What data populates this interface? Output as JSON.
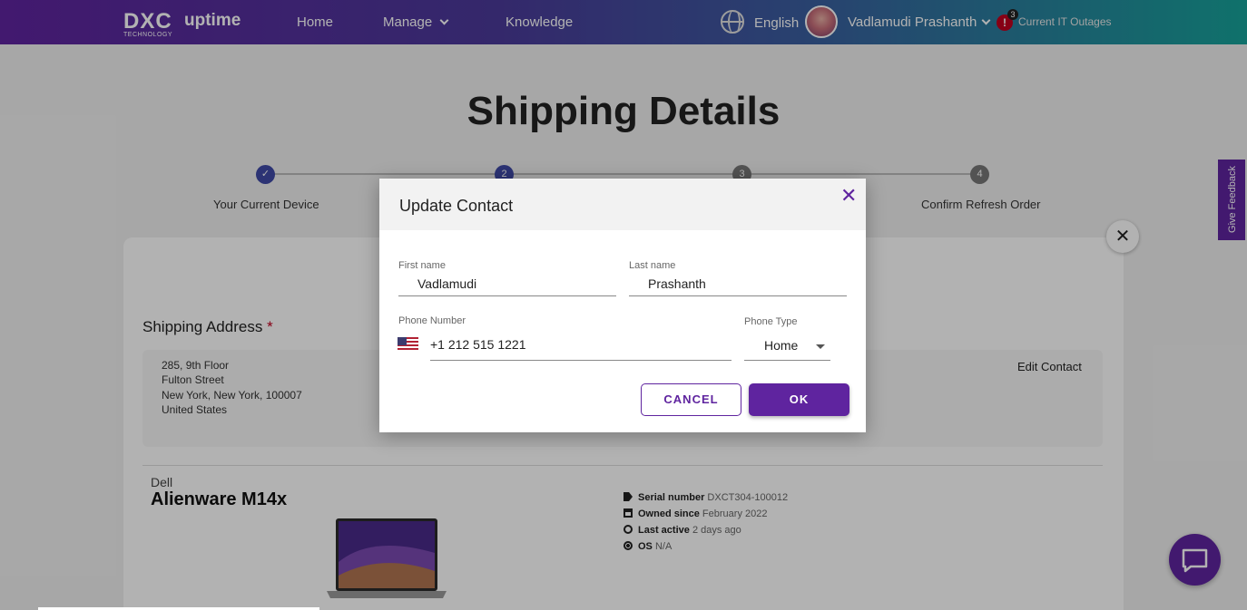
{
  "header": {
    "logo_dxc": "DXC",
    "logo_tech": "TECHNOLOGY",
    "logo_uptime": "uptime",
    "nav_home": "Home",
    "nav_manage": "Manage",
    "nav_knowledge": "Knowledge",
    "language": "English",
    "user_name": "Vadlamudi Prashanth",
    "alert_icon_text": "!",
    "alert_count": "3",
    "outages_label": "Current IT Outages"
  },
  "page": {
    "title": "Shipping Details",
    "steps": [
      {
        "number": "",
        "label": "Your Current Device"
      },
      {
        "number": "2",
        "label": ""
      },
      {
        "number": "3",
        "label": ""
      },
      {
        "number": "4",
        "label": "Confirm Refresh Order"
      }
    ],
    "shipping_address_label": "Shipping Address",
    "required_mark": "*",
    "address_lines": [
      "285, 9th Floor",
      "Fulton Street",
      "New York, New York, 100007",
      "United States"
    ],
    "edit_contact": "Edit Contact",
    "device": {
      "brand": "Dell",
      "model": "Alienware M14x",
      "specs": [
        {
          "label": "Serial number",
          "value": "DXCT304-100012",
          "icon": "tag-icon"
        },
        {
          "label": "Owned since",
          "value": "February 2022",
          "icon": "calendar-icon"
        },
        {
          "label": "Last active",
          "value": "2 days ago",
          "icon": "clock-icon"
        },
        {
          "label": "OS",
          "value": "N/A",
          "icon": "os-icon"
        }
      ]
    },
    "feedback_tab": "Give Feedback"
  },
  "modal": {
    "title": "Update Contact",
    "first_name_label": "First name",
    "first_name_value": "Vadlamudi",
    "last_name_label": "Last name",
    "last_name_value": "Prashanth",
    "phone_label": "Phone Number",
    "phone_value": "+1 212 515 1221",
    "phone_type_label": "Phone Type",
    "phone_type_value": "Home",
    "cancel_label": "CANCEL",
    "ok_label": "OK"
  },
  "colors": {
    "brand": "#5f249f",
    "step_done": "#3f4aa6",
    "step_pending": "#777777"
  }
}
